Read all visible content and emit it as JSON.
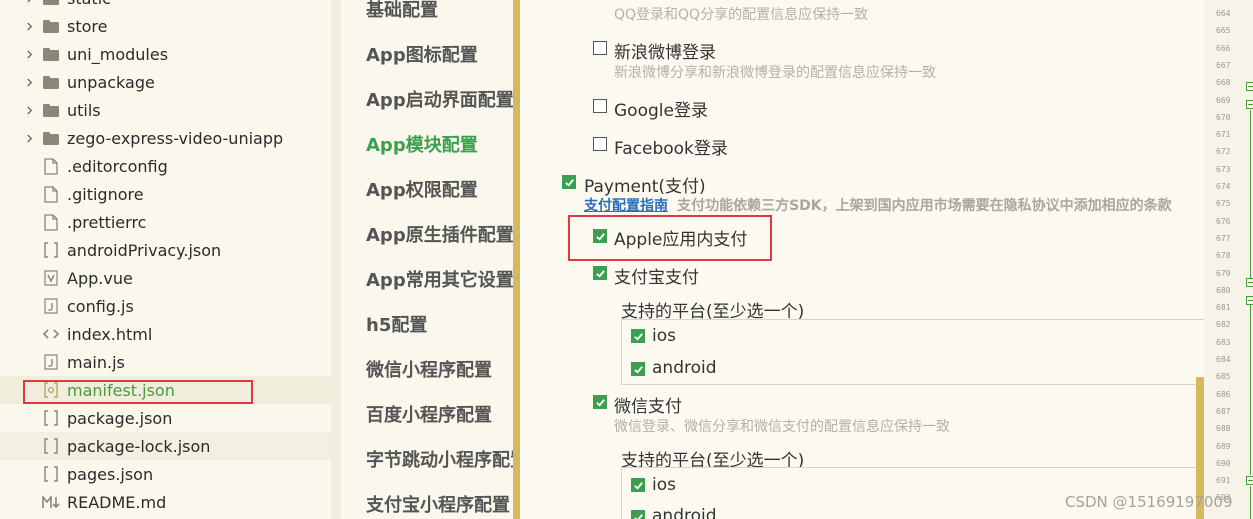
{
  "explorer": {
    "items": [
      {
        "type": "folder",
        "label": "static"
      },
      {
        "type": "folder",
        "label": "store"
      },
      {
        "type": "folder",
        "label": "uni_modules"
      },
      {
        "type": "folder",
        "label": "unpackage"
      },
      {
        "type": "folder",
        "label": "utils"
      },
      {
        "type": "folder",
        "label": "zego-express-video-uniapp"
      },
      {
        "type": "file",
        "icon": "file-icon",
        "label": ".editorconfig"
      },
      {
        "type": "file",
        "icon": "file-icon",
        "label": ".gitignore"
      },
      {
        "type": "file",
        "icon": "file-icon",
        "label": ".prettierrc"
      },
      {
        "type": "file",
        "icon": "json-icon",
        "label": "androidPrivacy.json"
      },
      {
        "type": "file",
        "icon": "vue-icon",
        "label": "App.vue"
      },
      {
        "type": "file",
        "icon": "js-icon",
        "label": "config.js"
      },
      {
        "type": "file",
        "icon": "html-icon",
        "label": "index.html"
      },
      {
        "type": "file",
        "icon": "js-icon",
        "label": "main.js"
      },
      {
        "type": "file",
        "icon": "gear-json-icon",
        "label": "manifest.json"
      },
      {
        "type": "file",
        "icon": "json-icon",
        "label": "package.json"
      },
      {
        "type": "file",
        "icon": "json-icon",
        "label": "package-lock.json"
      },
      {
        "type": "file",
        "icon": "json-icon",
        "label": "pages.json"
      },
      {
        "type": "file",
        "icon": "markdown-icon",
        "label": "README.md"
      }
    ]
  },
  "settings_nav": {
    "items": [
      {
        "label": "基础配置",
        "active": false
      },
      {
        "label": "App图标配置",
        "active": false
      },
      {
        "label": "App启动界面配置",
        "active": false
      },
      {
        "label": "App模块配置",
        "active": true
      },
      {
        "label": "App权限配置",
        "active": false
      },
      {
        "label": "App原生插件配置",
        "active": false
      },
      {
        "label": "App常用其它设置",
        "active": false
      },
      {
        "label": "h5配置",
        "active": false
      },
      {
        "label": "微信小程序配置",
        "active": false
      },
      {
        "label": "百度小程序配置",
        "active": false
      },
      {
        "label": "字节跳动小程序配置",
        "active": false
      },
      {
        "label": "支付宝小程序配置",
        "active": false
      }
    ]
  },
  "modules": {
    "qq_hint": "QQ登录和QQ分享的配置信息应保持一致",
    "sina_label": "新浪微博登录",
    "sina_checked": false,
    "sina_hint": "新浪微博分享和新浪微博登录的配置信息应保持一致",
    "google_label": "Google登录",
    "google_checked": false,
    "facebook_label": "Facebook登录",
    "facebook_checked": false,
    "payment_label": "Payment(支付)",
    "payment_checked": true,
    "payment_link": "支付配置指南",
    "payment_warning": "支付功能依赖三方SDK，上架到国内应用市场需要在隐私协议中添加相应的条款",
    "apple_pay_label": "Apple应用内支付",
    "apple_pay_checked": true,
    "alipay_label": "支付宝支付",
    "alipay_checked": true,
    "alipay_platform_title": "支持的平台(至少选一个)",
    "alipay_ios": "ios",
    "alipay_android": "android",
    "wxpay_label": "微信支付",
    "wxpay_checked": true,
    "wxpay_hint": "微信登录、微信分享和微信支付的配置信息应保持一致",
    "wxpay_platform_title": "支持的平台(至少选一个)",
    "wxpay_ios": "ios",
    "wxpay_android": "android"
  },
  "gutter": {
    "line_numbers": [
      "664",
      "665",
      "666",
      "667",
      "668",
      "669",
      "670",
      "671",
      "672",
      "673",
      "674",
      "675",
      "676",
      "677",
      "678",
      "679",
      "680",
      "681",
      "682",
      "683",
      "684",
      "685",
      "686",
      "687",
      "688",
      "689",
      "690",
      "691",
      "692"
    ]
  },
  "watermark": "CSDN @15169197009",
  "colors": {
    "accent_green": "#3c9f50",
    "highlight_red": "#e0393e",
    "scrollbar": "#d6b860",
    "link_blue": "#2a6ebd"
  }
}
